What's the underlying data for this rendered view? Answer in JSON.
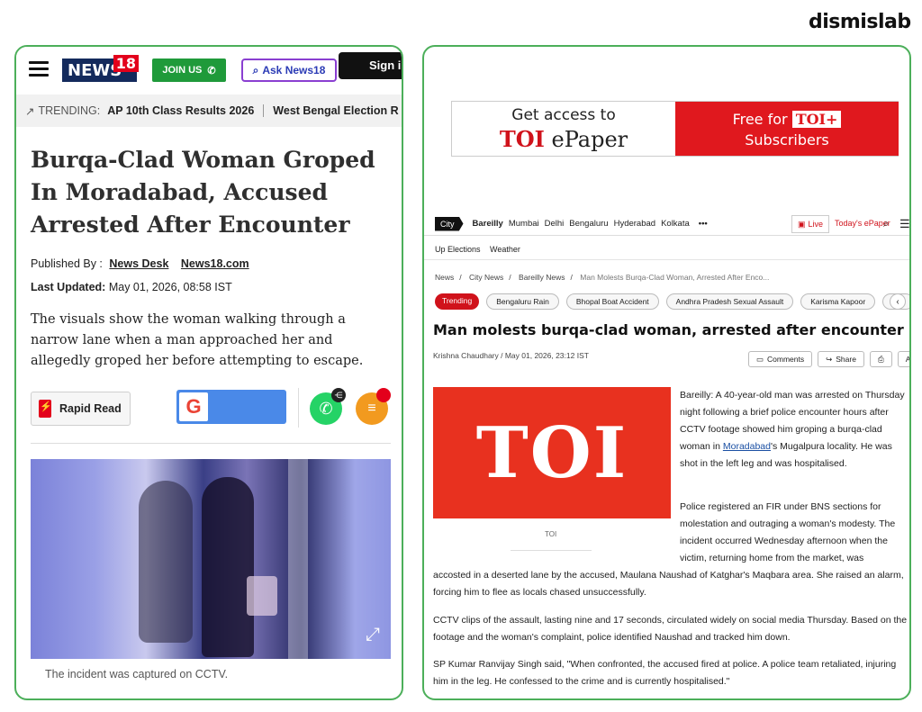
{
  "brand": "dismislab",
  "news18": {
    "header": {
      "logo_text": "NEWS",
      "logo_num": "18",
      "join_label": "JOIN US",
      "ask_label": "Ask News18",
      "signin_label": "Sign in"
    },
    "trending": {
      "label": "TRENDING:",
      "items": [
        "AP 10th Class Results 2026",
        "West Bengal Election R"
      ]
    },
    "title": "Burqa-Clad Woman Groped In Moradabad, Accused Arrested After Encounter",
    "published_by_label": "Published By :",
    "published_by": "News Desk",
    "source": "News18.com",
    "updated_label": "Last Updated:",
    "updated": "May 01, 2026, 08:58 IST",
    "summary": "The visuals show the woman walking through a narrow lane when a man approached her and allegedly groped her before attempting to escape.",
    "rapid_read_label": "Rapid Read",
    "google_label": "G",
    "caption": "The incident was captured on CCTV."
  },
  "toi": {
    "ad": {
      "left_line1": "Get access to",
      "left_toi": "TOI",
      "left_epaper": " ePaper",
      "right_free": "Free for",
      "right_badge": "TOI+",
      "right_line2": "Subscribers"
    },
    "nav": {
      "city_label": "City",
      "cities": [
        "Bareilly",
        "Mumbai",
        "Delhi",
        "Bengaluru",
        "Hyderabad",
        "Kolkata"
      ],
      "more": "•••",
      "live_label": "Live",
      "todays_epaper": "Today's ePaper"
    },
    "sub_nav": [
      "Up Elections",
      "Weather"
    ],
    "breadcrumbs": [
      "News",
      "City News",
      "Bareilly News",
      "Man Molests Burqa-Clad Woman, Arrested After Enco..."
    ],
    "trending": {
      "label": "Trending",
      "chips": [
        "Bengaluru Rain",
        "Bhopal Boat Accident",
        "Andhra Pradesh Sexual Assault",
        "Karisma Kapoor",
        "Del"
      ]
    },
    "title": "Man molests burqa-clad woman, arrested after encounter",
    "byline": "Krishna Chaudhary / May 01, 2026, 23:12 IST",
    "actions": {
      "comments": "Comments",
      "share": "Share",
      "font": "AA"
    },
    "image_text": "TOI",
    "image_caption": "TOI",
    "p1_before": "Bareilly: A 40-year-old man was arrested on Thursday night following a brief police encounter hours after CCTV footage showed him groping a burqa-clad woman in ",
    "p1_link": "Moradabad",
    "p1_after": "'s Mugalpura locality. He was shot in the left leg and was hospitalised.",
    "p2_a": "Police registered an FIR under BNS sections for molestation and outraging a woman's modesty. The incident occurred Wednesday afternoon when the victim, returning home from the market, was",
    "p2_b": "accosted in a deserted lane by the accused, Maulana Naushad of Katghar's Maqbara area. She raised an alarm, forcing him to flee as locals chased unsuccessfully.",
    "p3": "CCTV clips of the assault, lasting nine and 17 seconds, circulated widely on social media Thursday. Based on the footage and the woman's complaint, police identified Naushad and tracked him down.",
    "p4": "SP Kumar Ranvijay Singh said, \"When confronted, the accused fired at police. A police team retaliated, injuring him in the leg. He confessed to the crime and is currently hospitalised.\""
  }
}
